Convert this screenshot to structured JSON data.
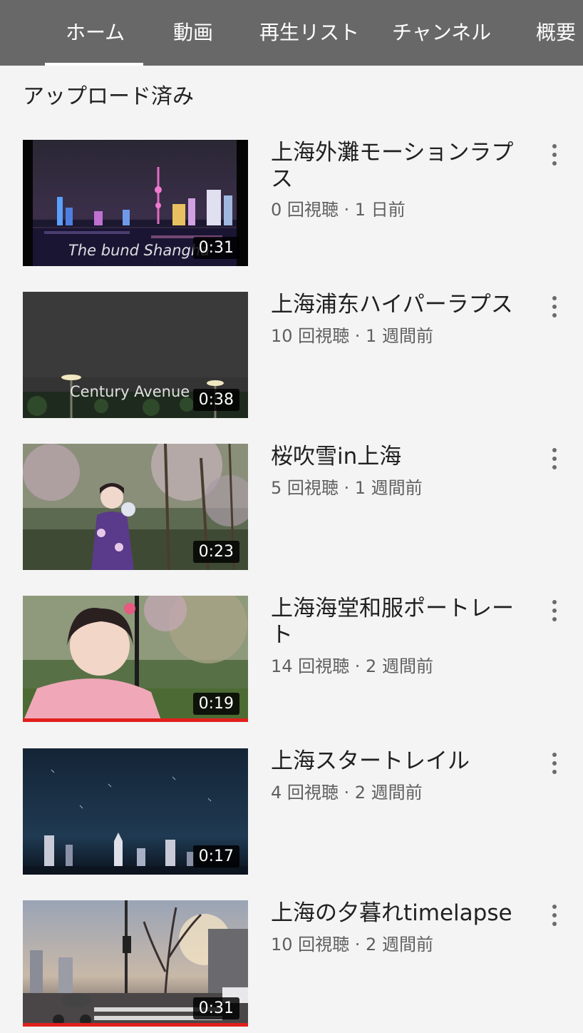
{
  "tabs": [
    {
      "label": "ホーム",
      "active": true
    },
    {
      "label": "動画"
    },
    {
      "label": "再生リスト"
    },
    {
      "label": "チャンネル"
    },
    {
      "label": "概要"
    }
  ],
  "section_title": "アップロード済み",
  "videos": [
    {
      "title": "上海外灘モーションラプス",
      "meta": "0 回視聴 · 1 日前",
      "duration": "0:31",
      "overlay": "The bund Shangha"
    },
    {
      "title": "上海浦东ハイパーラプス",
      "meta": "10 回視聴 · 1 週間前",
      "duration": "0:38",
      "overlay": "Century Avenue"
    },
    {
      "title": "桜吹雪in上海",
      "meta": "5 回視聴 · 1 週間前",
      "duration": "0:23"
    },
    {
      "title": "上海海堂和服ポートレート",
      "meta": "14 回視聴 · 2 週間前",
      "duration": "0:19",
      "watched_fraction": 1.0
    },
    {
      "title": "上海スタートレイル",
      "meta": "4 回視聴 · 2 週間前",
      "duration": "0:17"
    },
    {
      "title": "上海の夕暮れtimelapse",
      "meta": "10 回視聴 · 2 週間前",
      "duration": "0:31",
      "watched_fraction": 1.0
    }
  ],
  "icons": {
    "more": "more-vert-icon"
  },
  "colors": {
    "tabbar": "#686868",
    "progress": "#e0201c",
    "background": "#f4f4f4"
  }
}
